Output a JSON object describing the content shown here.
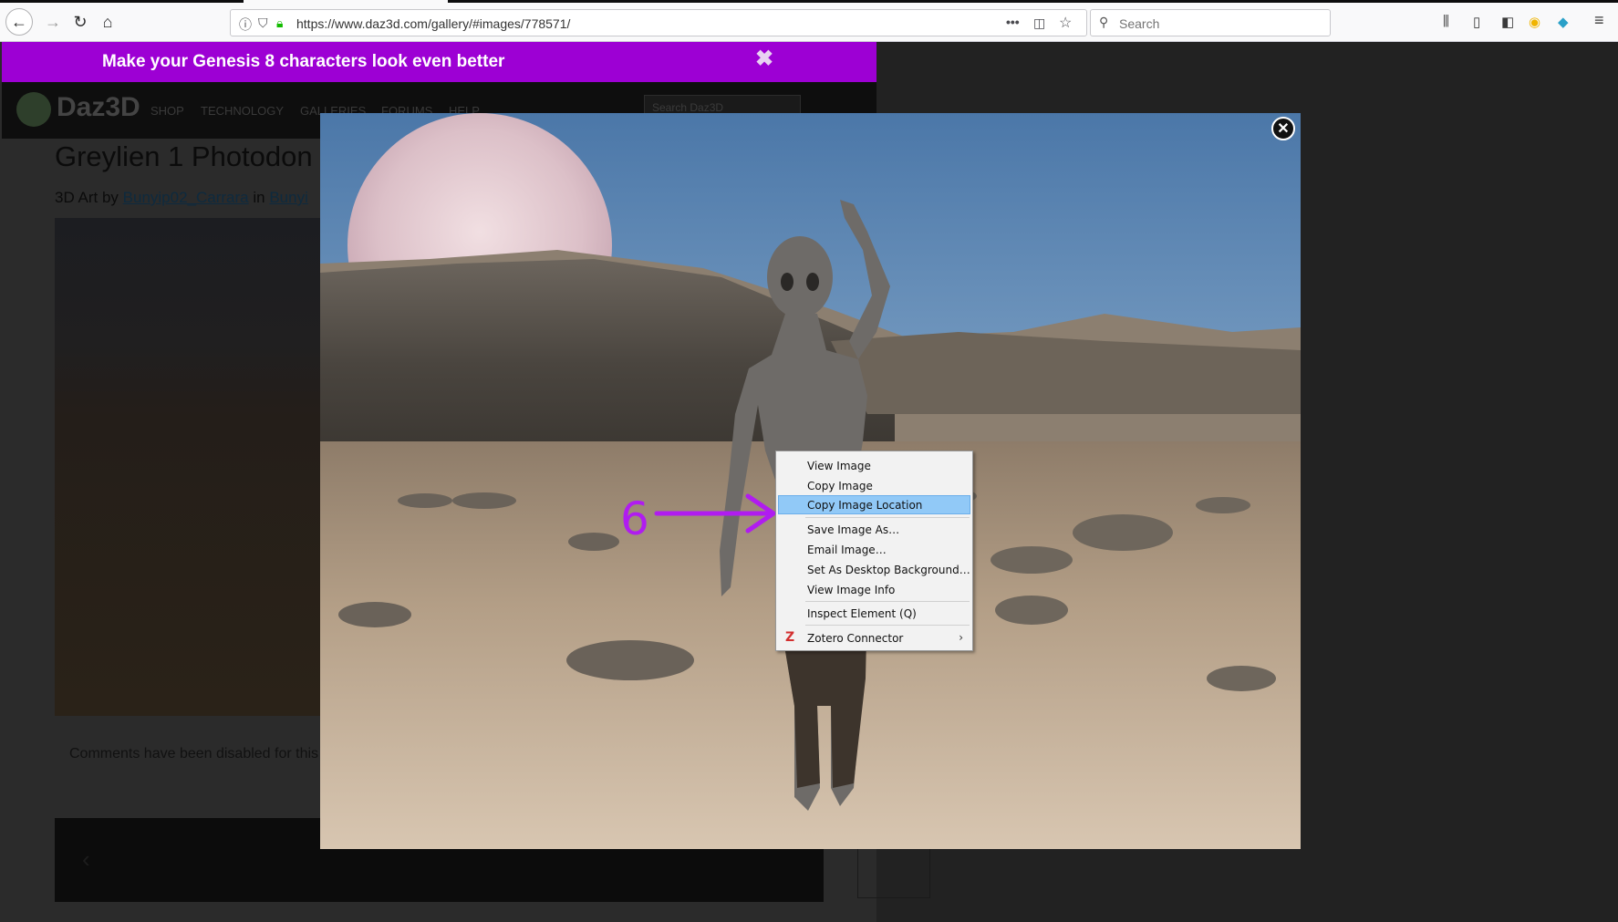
{
  "browser": {
    "url": "https://www.daz3d.com/gallery/#images/778571/",
    "search_placeholder": "Search"
  },
  "promo": {
    "text": "Make your Genesis 8 characters look even better",
    "close_glyph": "✖"
  },
  "site": {
    "logo_text": "Daz3D",
    "menu": [
      "SHOP",
      "TECHNOLOGY",
      "GALLERIES",
      "FORUMS",
      "HELP"
    ],
    "search_placeholder": "Search Daz3D"
  },
  "gallery": {
    "title": "Greylien 1 Photodon",
    "byline_prefix": "3D Art by",
    "byline_author": "Bunyip02_Carrara",
    "byline_in": "in",
    "byline_gallery": "Bunyi",
    "comments_text": "Comments have been disabled for this"
  },
  "context_menu": {
    "items": [
      "View Image",
      "Copy Image",
      "Copy Image Location",
      "Save Image As…",
      "Email Image…",
      "Set As Desktop Background…",
      "View Image Info",
      "Inspect Element (Q)",
      "Zotero Connector"
    ],
    "highlighted": "Copy Image Location"
  },
  "annotation": {
    "number": "6",
    "color": "#b01cf0"
  }
}
